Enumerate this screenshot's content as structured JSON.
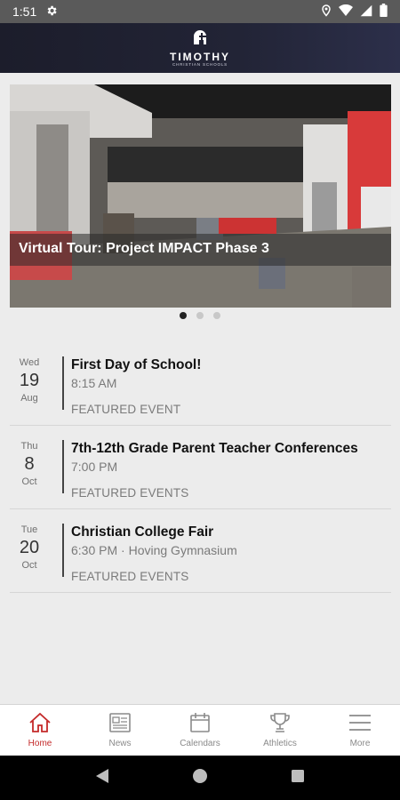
{
  "status_bar": {
    "time": "1:51"
  },
  "header": {
    "logo_title": "TIMOTHY",
    "logo_subtitle": "CHRISTIAN SCHOOLS"
  },
  "hero": {
    "caption": "Virtual Tour: Project IMPACT Phase 3",
    "slide_count": 3,
    "active_slide": 1
  },
  "events": [
    {
      "dow": "Wed",
      "day": "19",
      "month": "Aug",
      "title": "First Day of School!",
      "time": "8:15 AM",
      "category": "FEATURED EVENT"
    },
    {
      "dow": "Thu",
      "day": "8",
      "month": "Oct",
      "title": "7th-12th Grade Parent Teacher Conferences",
      "time": "7:00 PM",
      "category": "FEATURED EVENTS"
    },
    {
      "dow": "Tue",
      "day": "20",
      "month": "Oct",
      "title": "Christian College Fair",
      "time": "6:30 PM · Hoving Gymnasium",
      "category": "FEATURED EVENTS"
    }
  ],
  "tabs": [
    {
      "label": "Home",
      "icon": "home-icon",
      "active": true
    },
    {
      "label": "News",
      "icon": "news-icon",
      "active": false
    },
    {
      "label": "Calendars",
      "icon": "calendar-icon",
      "active": false
    },
    {
      "label": "Athletics",
      "icon": "trophy-icon",
      "active": false
    },
    {
      "label": "More",
      "icon": "menu-icon",
      "active": false
    }
  ],
  "colors": {
    "accent": "#c42a2a",
    "header_bg": "#1f2030",
    "background": "#ececec"
  }
}
